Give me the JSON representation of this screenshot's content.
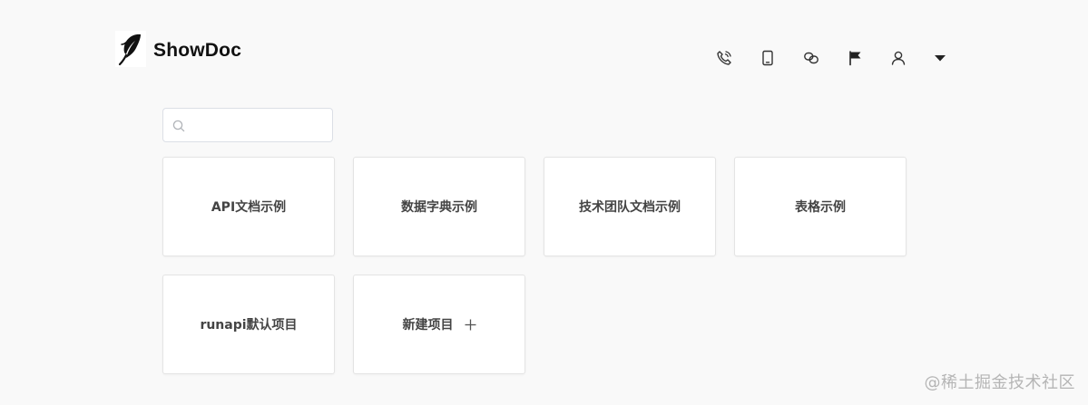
{
  "header": {
    "brand": "ShowDoc",
    "toolbar": [
      {
        "icon": "phone-icon"
      },
      {
        "icon": "mobile-icon"
      },
      {
        "icon": "link-icon"
      },
      {
        "icon": "flag-icon"
      },
      {
        "icon": "user-icon"
      },
      {
        "icon": "caret-down-icon"
      }
    ]
  },
  "search": {
    "value": "",
    "placeholder": ""
  },
  "projects": [
    {
      "label": "API文档示例"
    },
    {
      "label": "数据字典示例"
    },
    {
      "label": "技术团队文档示例"
    },
    {
      "label": "表格示例"
    },
    {
      "label": "runapi默认项目"
    }
  ],
  "new_project": {
    "label": "新建项目"
  },
  "watermark": "@稀土掘金技术社区",
  "colors": {
    "background": "#f9f9f9",
    "card_border": "#e4e4e4",
    "text": "#444444"
  }
}
